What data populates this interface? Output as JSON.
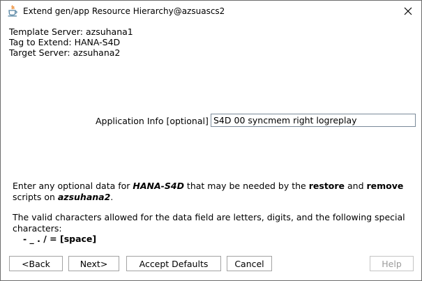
{
  "window": {
    "title": "Extend gen/app Resource Hierarchy@azsuascs2"
  },
  "info": {
    "template_server": "Template Server: azsuhana1",
    "tag_to_extend": "Tag to Extend: HANA-S4D",
    "target_server": "Target Server: azsuhana2"
  },
  "app_info": {
    "label": "Application Info [optional]",
    "value": "S4D 00 syncmem right logreplay"
  },
  "message": {
    "p1_a": "Enter any optional data for ",
    "p1_tag": "HANA-S4D",
    "p1_b": " that may be needed by the ",
    "p1_restore": "restore",
    "p1_c": " and ",
    "p1_remove": "remove",
    "p1_d": " scripts on ",
    "p1_server": "azsuhana2",
    "p1_e": ".",
    "p2": "The valid characters allowed for the data field are letters, digits, and the following special characters:",
    "chars": "- _ . / = [space]"
  },
  "buttons": {
    "back": "<Back",
    "next": "Next>",
    "accept_defaults": "Accept Defaults",
    "cancel": "Cancel",
    "help": "Help"
  },
  "icons": {
    "app": "java-coffee-cup-icon",
    "close": "close-icon"
  },
  "colors": {
    "background": "#ffffff",
    "java_blue": "#5382a1",
    "java_orange": "#e76f00",
    "disabled_text": "#9a9a9a"
  }
}
